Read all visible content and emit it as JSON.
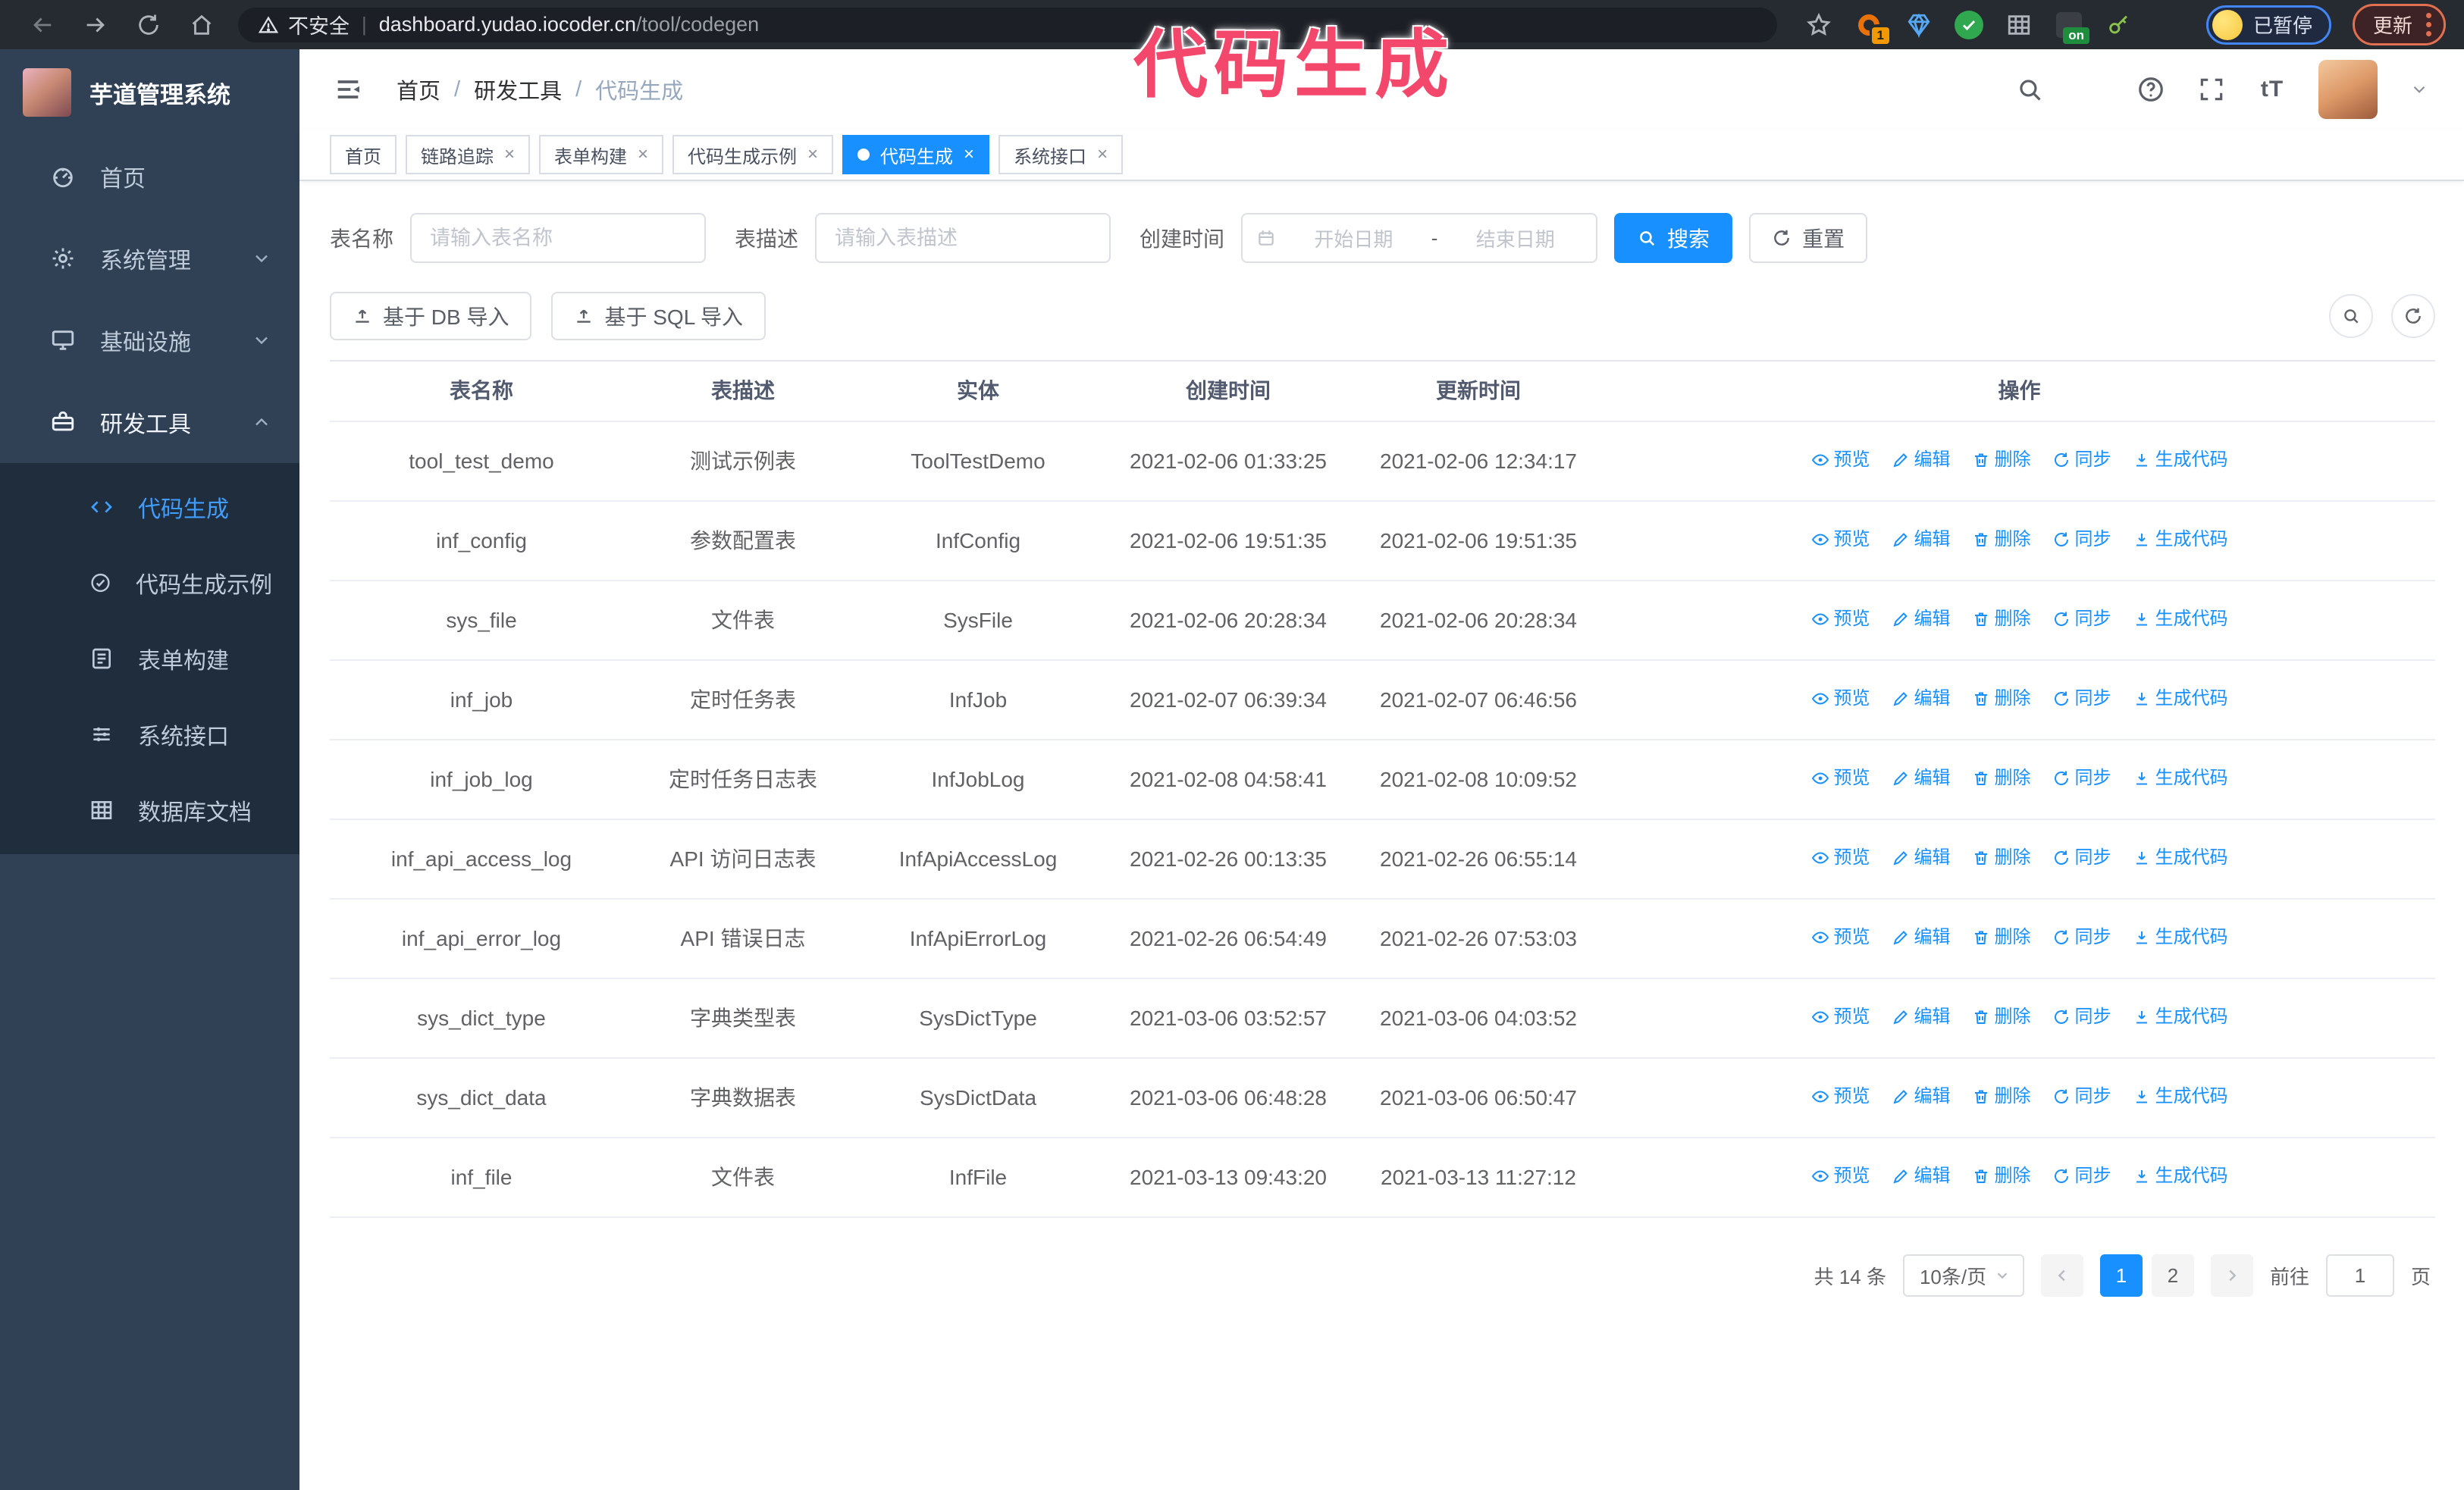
{
  "overlay": {
    "text": "代码生成"
  },
  "browser": {
    "security_text": "不安全",
    "url_host": "dashboard.yudao.iocoder.cn",
    "url_path": "/tool/codegen",
    "extensions": [
      {
        "id": "orange-c",
        "badge": "1"
      },
      {
        "id": "blue-gem"
      },
      {
        "id": "green-check"
      },
      {
        "id": "grey-columns"
      },
      {
        "id": "dark-on",
        "badge": "on"
      },
      {
        "id": "green-key"
      },
      {
        "id": "puzzle"
      }
    ],
    "paused_label": "已暂停",
    "update_label": "更新"
  },
  "sidebar": {
    "app_title": "芋道管理系统",
    "items": [
      {
        "id": "home",
        "icon": "dashboard-icon",
        "label": "首页"
      },
      {
        "id": "system",
        "icon": "gear-icon",
        "label": "系统管理",
        "chevron": "down"
      },
      {
        "id": "infra",
        "icon": "monitor-icon",
        "label": "基础设施",
        "chevron": "down"
      },
      {
        "id": "dev-tools",
        "icon": "toolbox-icon",
        "label": "研发工具",
        "chevron": "up",
        "expanded": true
      }
    ],
    "submenu": [
      {
        "id": "codegen",
        "icon": "code-icon",
        "label": "代码生成",
        "active": true
      },
      {
        "id": "codegen-example",
        "icon": "check-circle-icon",
        "label": "代码生成示例"
      },
      {
        "id": "form-builder",
        "icon": "form-icon",
        "label": "表单构建"
      },
      {
        "id": "system-api",
        "icon": "sliders-icon",
        "label": "系统接口"
      },
      {
        "id": "db-doc",
        "icon": "grid-icon",
        "label": "数据库文档"
      }
    ]
  },
  "breadcrumb": {
    "separator": "/",
    "items": [
      {
        "label": "首页",
        "current": false
      },
      {
        "label": "研发工具",
        "current": false
      },
      {
        "label": "代码生成",
        "current": true
      }
    ]
  },
  "topbar": {
    "icons": [
      "search-icon",
      "github-icon",
      "question-icon",
      "fullscreen-icon",
      "font-size-icon"
    ]
  },
  "tabs": [
    {
      "id": "home",
      "label": "首页",
      "closable": false,
      "active": false
    },
    {
      "id": "tracing",
      "label": "链路追踪",
      "closable": true,
      "active": false
    },
    {
      "id": "form-builder",
      "label": "表单构建",
      "closable": true,
      "active": false
    },
    {
      "id": "codegen-example",
      "label": "代码生成示例",
      "closable": true,
      "active": false
    },
    {
      "id": "codegen",
      "label": "代码生成",
      "closable": true,
      "active": true
    },
    {
      "id": "system-api",
      "label": "系统接口",
      "closable": true,
      "active": false
    }
  ],
  "filters": {
    "name_label": "表名称",
    "name_placeholder": "请输入表名称",
    "desc_label": "表描述",
    "desc_placeholder": "请输入表描述",
    "time_label": "创建时间",
    "start_placeholder": "开始日期",
    "range_separator": "-",
    "end_placeholder": "结束日期",
    "search_label": "搜索",
    "reset_label": "重置"
  },
  "toolbar": {
    "db_import": "基于 DB 导入",
    "sql_import": "基于 SQL 导入"
  },
  "table": {
    "columns": [
      "表名称",
      "表描述",
      "实体",
      "创建时间",
      "更新时间",
      "操作"
    ],
    "actions": [
      {
        "label": "预览",
        "icon": "eye-icon"
      },
      {
        "label": "编辑",
        "icon": "edit-icon"
      },
      {
        "label": "删除",
        "icon": "delete-icon"
      },
      {
        "label": "同步",
        "icon": "sync-icon"
      },
      {
        "label": "生成代码",
        "icon": "download-icon"
      }
    ],
    "rows": [
      {
        "name": "tool_test_demo",
        "desc": "测试示例表",
        "entity": "ToolTestDemo",
        "created": "2021-02-06 01:33:25",
        "updated": "2021-02-06 12:34:17"
      },
      {
        "name": "inf_config",
        "desc": "参数配置表",
        "entity": "InfConfig",
        "created": "2021-02-06 19:51:35",
        "updated": "2021-02-06 19:51:35"
      },
      {
        "name": "sys_file",
        "desc": "文件表",
        "entity": "SysFile",
        "created": "2021-02-06 20:28:34",
        "updated": "2021-02-06 20:28:34"
      },
      {
        "name": "inf_job",
        "desc": "定时任务表",
        "entity": "InfJob",
        "created": "2021-02-07 06:39:34",
        "updated": "2021-02-07 06:46:56"
      },
      {
        "name": "inf_job_log",
        "desc": "定时任务日志表",
        "entity": "InfJobLog",
        "created": "2021-02-08 04:58:41",
        "updated": "2021-02-08 10:09:52"
      },
      {
        "name": "inf_api_access_log",
        "desc": "API 访问日志表",
        "entity": "InfApiAccessLog",
        "created": "2021-02-26 00:13:35",
        "updated": "2021-02-26 06:55:14"
      },
      {
        "name": "inf_api_error_log",
        "desc": "API 错误日志",
        "entity": "InfApiErrorLog",
        "created": "2021-02-26 06:54:49",
        "updated": "2021-02-26 07:53:03"
      },
      {
        "name": "sys_dict_type",
        "desc": "字典类型表",
        "entity": "SysDictType",
        "created": "2021-03-06 03:52:57",
        "updated": "2021-03-06 04:03:52"
      },
      {
        "name": "sys_dict_data",
        "desc": "字典数据表",
        "entity": "SysDictData",
        "created": "2021-03-06 06:48:28",
        "updated": "2021-03-06 06:50:47"
      },
      {
        "name": "inf_file",
        "desc": "文件表",
        "entity": "InfFile",
        "created": "2021-03-13 09:43:20",
        "updated": "2021-03-13 11:27:12"
      }
    ]
  },
  "pagination": {
    "total": "共 14 条",
    "page_size": "10条/页",
    "pages": [
      "1",
      "2"
    ],
    "active_page": "1",
    "goto_label": "前往",
    "goto_value": "1",
    "page_suffix": "页"
  },
  "colors": {
    "accent": "#1890ff",
    "menu_active": "#409EFF",
    "sidebar_bg": "#304156",
    "submenu_bg": "#1f2d3d",
    "overlay_pink": "#f4476c"
  }
}
